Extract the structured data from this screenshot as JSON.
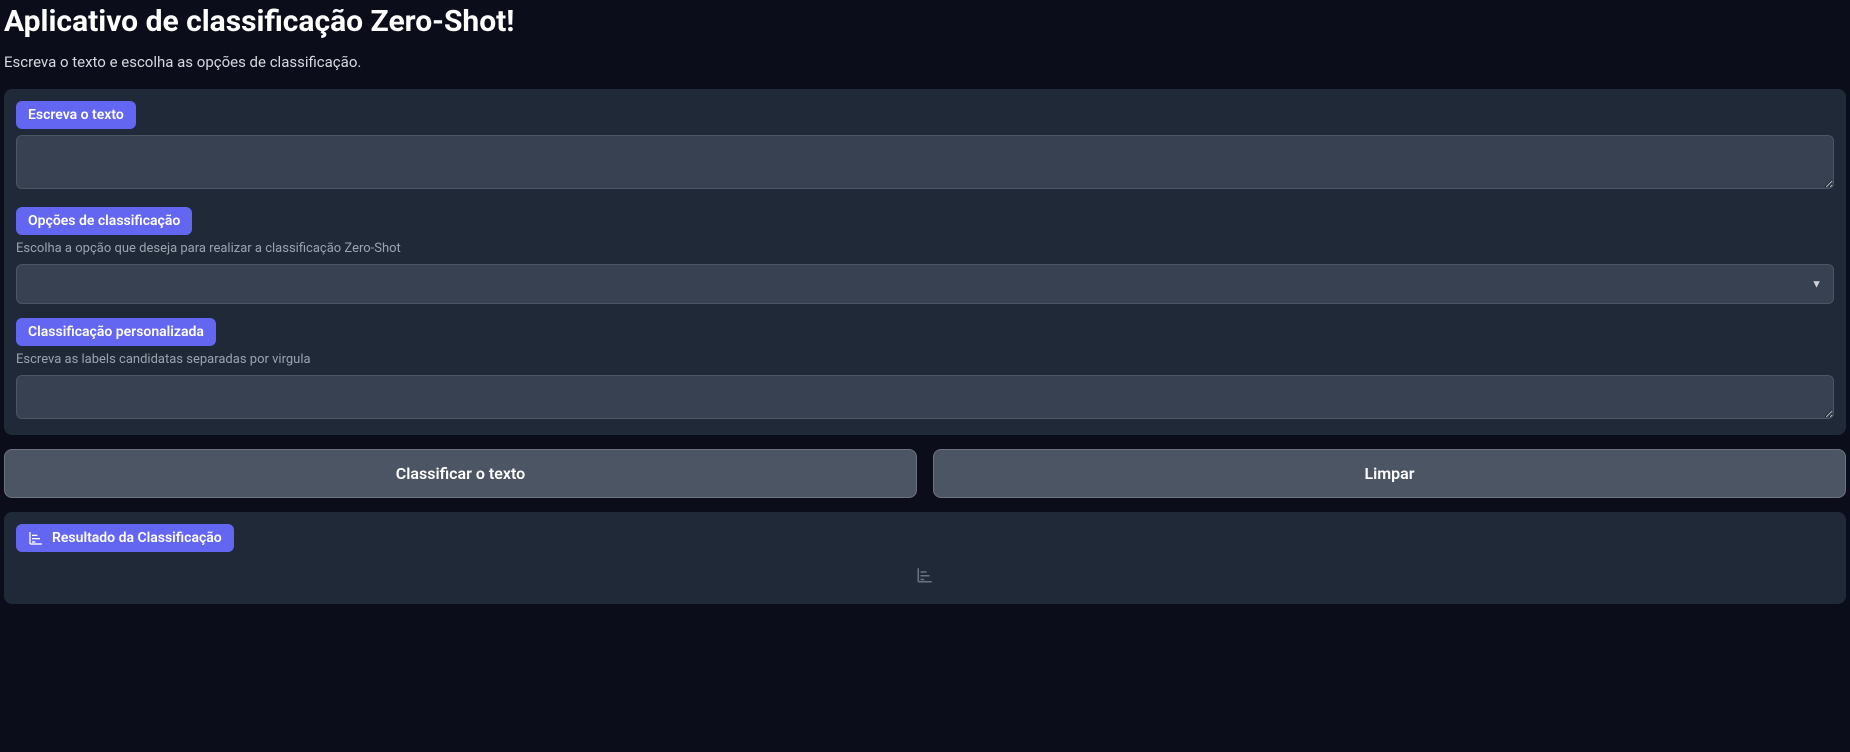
{
  "header": {
    "title": "Aplicativo de classificação Zero-Shot!",
    "subtitle": "Escreva o texto e escolha as opções de classificação."
  },
  "form": {
    "text_input": {
      "label": "Escreva o texto",
      "value": ""
    },
    "classification_options": {
      "label": "Opções de classificação",
      "description": "Escolha a opção que deseja para realizar a classificação Zero-Shot",
      "selected": ""
    },
    "custom_classification": {
      "label": "Classificação personalizada",
      "description": "Escreva as labels candidatas separadas por virgula",
      "value": ""
    }
  },
  "buttons": {
    "classify": "Classificar o texto",
    "clear": "Limpar"
  },
  "result": {
    "label": "Resultado da Classificação"
  }
}
